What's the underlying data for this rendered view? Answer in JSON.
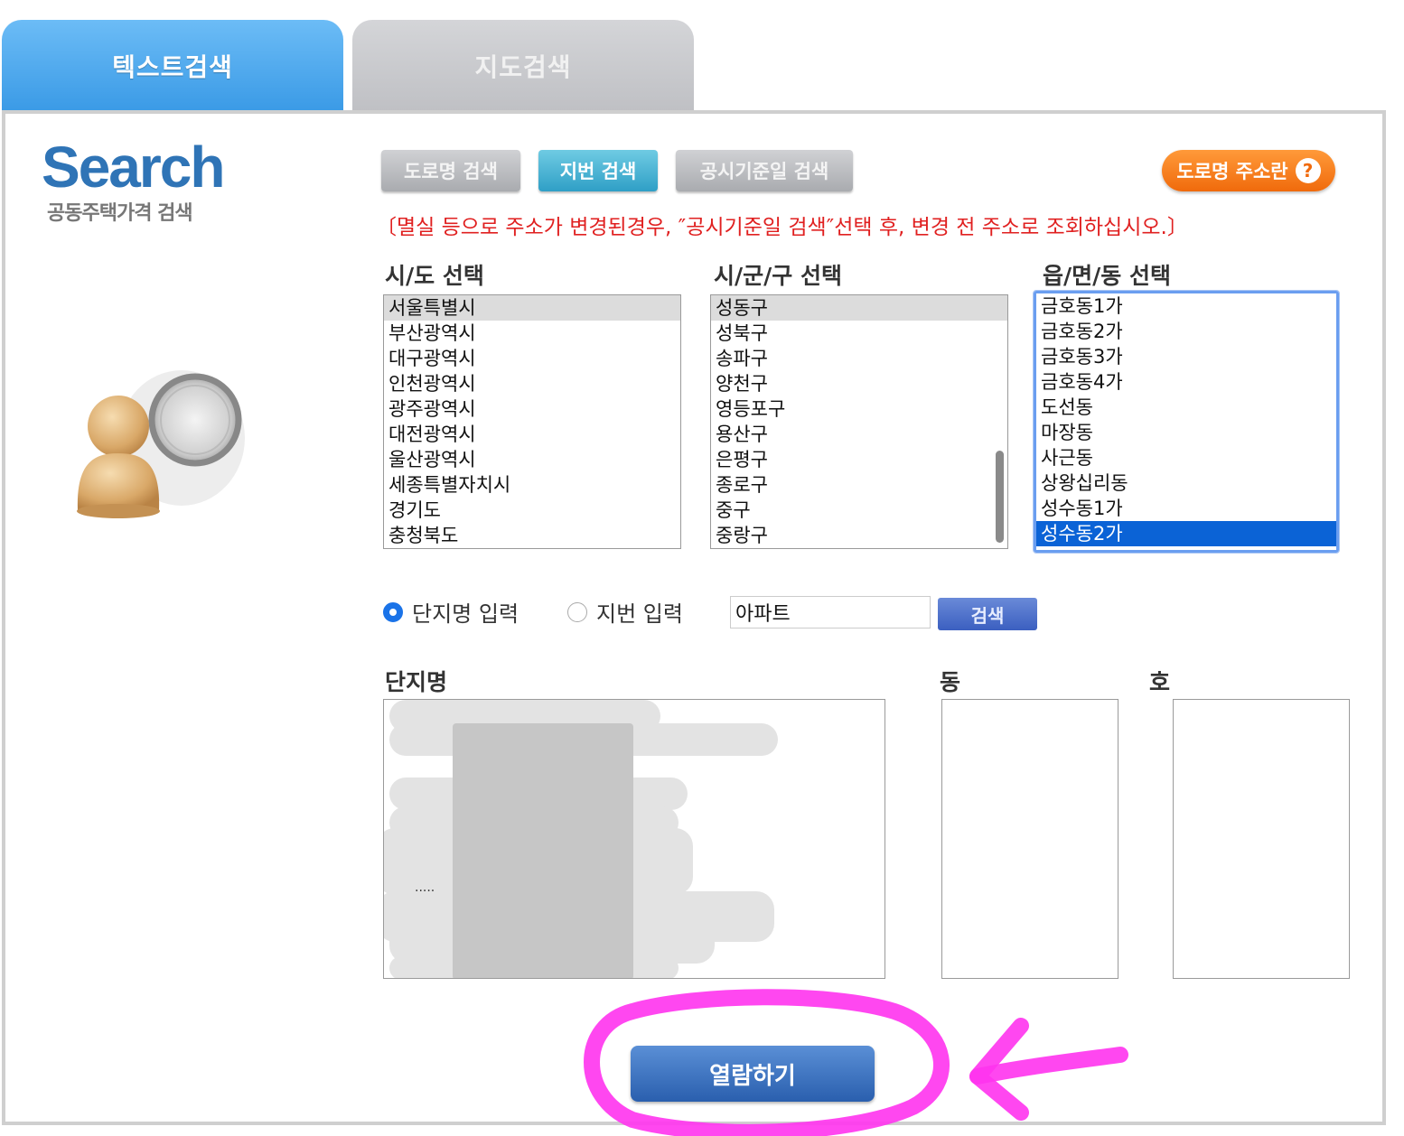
{
  "tabs": {
    "text_search": "텍스트검색",
    "map_search": "지도검색"
  },
  "logo": {
    "title": "Search",
    "subtitle": "공동주택가격 검색"
  },
  "subtabs": {
    "road_name": "도로명 검색",
    "lot_number": "지번 검색",
    "notice_date": "공시기준일 검색",
    "active": "지번 검색"
  },
  "road_info": {
    "label": "도로명 주소란",
    "icon": "question-icon"
  },
  "notice": "〔멸실 등으로 주소가 변경된경우, ″공시기준일 검색″선택 후, 변경 전 주소로 조회하십시오.〕",
  "sido": {
    "label": "시/도 선택",
    "options": [
      "서울특별시",
      "부산광역시",
      "대구광역시",
      "인천광역시",
      "광주광역시",
      "대전광역시",
      "울산광역시",
      "세종특별자치시",
      "경기도",
      "충청북도"
    ],
    "selected": "서울특별시"
  },
  "sigungu": {
    "label": "시/군/구 선택",
    "options": [
      "성동구",
      "성북구",
      "송파구",
      "양천구",
      "영등포구",
      "용산구",
      "은평구",
      "종로구",
      "중구",
      "중랑구"
    ],
    "selected": "성동구"
  },
  "eupmyeondong": {
    "label": "읍/면/동 선택",
    "options": [
      "금호동1가",
      "금호동2가",
      "금호동3가",
      "금호동4가",
      "도선동",
      "마장동",
      "사근동",
      "상왕십리동",
      "성수동1가",
      "성수동2가"
    ],
    "selected": "성수동2가"
  },
  "radios": {
    "complex_name": "단지명 입력",
    "lot_input": "지번 입력",
    "checked": "단지명 입력"
  },
  "search": {
    "value": "아파트",
    "button": "검색"
  },
  "results": {
    "complex_label": "단지명",
    "dong_label": "동",
    "ho_label": "호",
    "ellipsis": "....."
  },
  "view_button": "열람하기",
  "colors": {
    "accent_blue": "#3a9ae6",
    "active_subtab": "#2f9fc6",
    "road_info_orange": "#f06a0c",
    "notice_red": "#e02020",
    "annotation_magenta": "#ff33ee"
  }
}
